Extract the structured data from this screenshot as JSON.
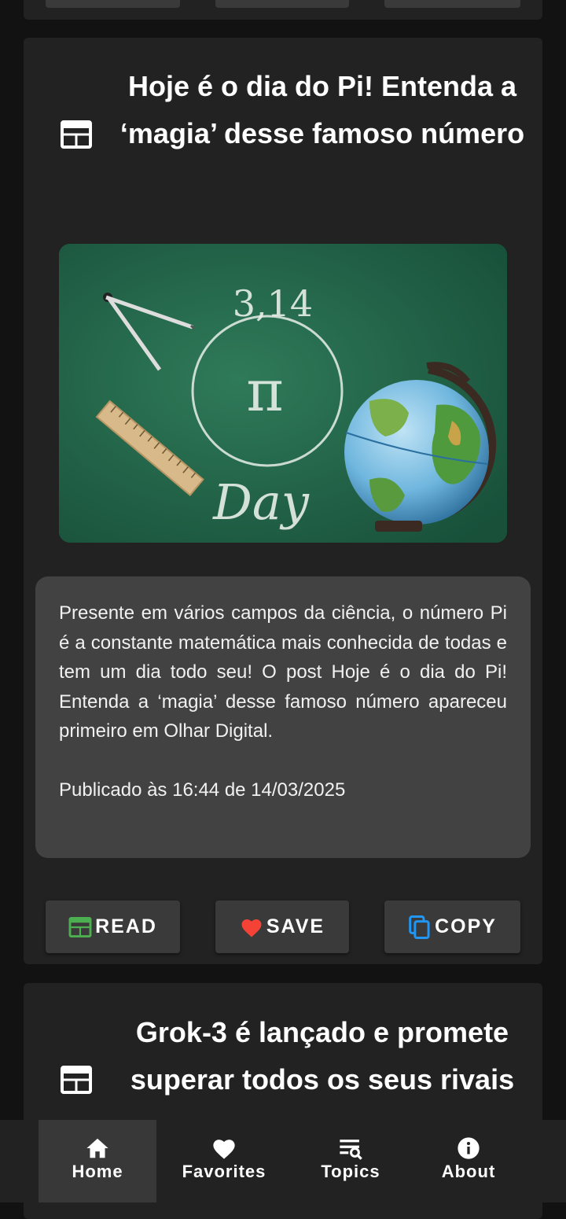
{
  "articles": [
    {
      "title": "Hoje é o dia do Pi! Entenda a ‘magia’ desse famoso número",
      "image": {
        "chalk_number": "3,14",
        "chalk_symbol": "π",
        "chalk_word": "Day"
      },
      "description": "Presente em vários campos da ciência, o número Pi é a constante matemática mais conhecida de todas e tem um dia todo seu! O post Hoje é o dia do Pi! Entenda a ‘magia’ desse famoso número apareceu primeiro em Olhar Digital.",
      "published": "Publicado às 16:44 de 14/03/2025"
    },
    {
      "title": "Grok-3 é lançado e promete superar todos os seus rivais"
    }
  ],
  "actions": {
    "read_label": "READ",
    "save_label": "SAVE",
    "copy_label": "COPY"
  },
  "nav": {
    "items": [
      {
        "label": "Home",
        "icon": "home-icon"
      },
      {
        "label": "Favorites",
        "icon": "heart-icon"
      },
      {
        "label": "Topics",
        "icon": "topics-search-icon"
      },
      {
        "label": "About",
        "icon": "info-icon"
      }
    ],
    "active": "Home"
  },
  "colors": {
    "background": "#121212",
    "card": "#222222",
    "description_box": "#424242",
    "button": "#3a3a3a",
    "read_icon": "#4caf50",
    "save_icon": "#f44336",
    "copy_icon": "#2196f3",
    "nav_active": "#383838"
  }
}
